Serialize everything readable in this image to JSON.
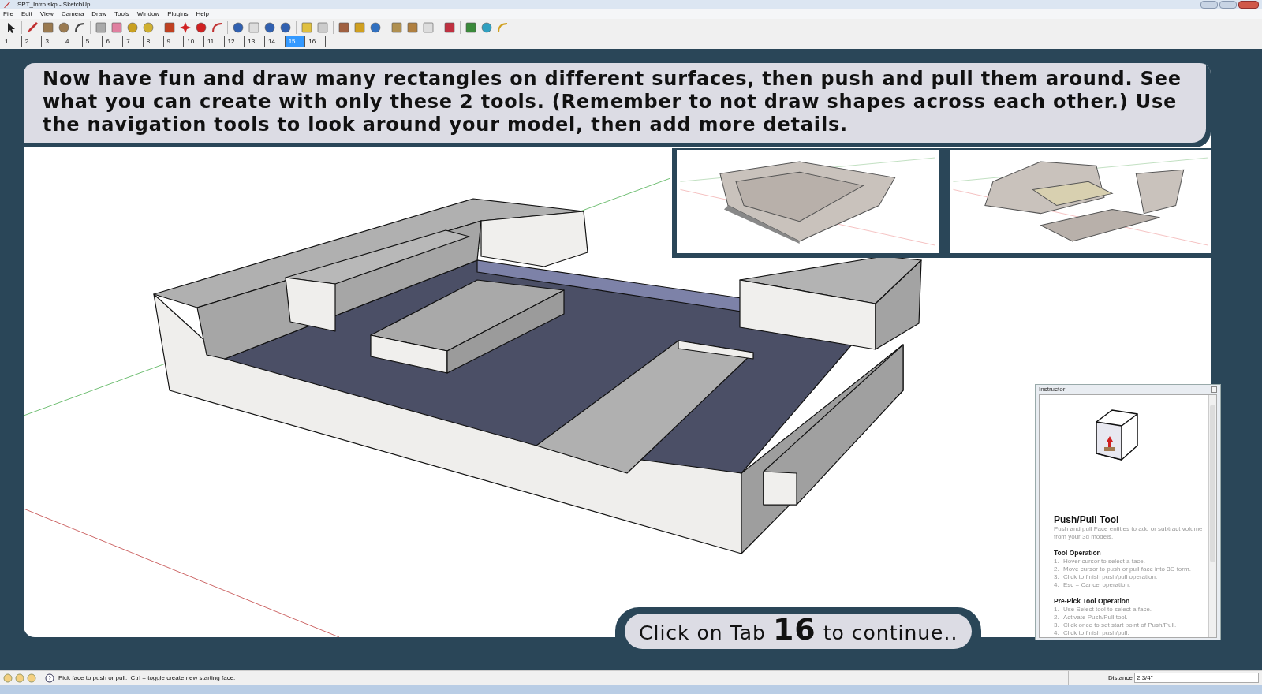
{
  "window": {
    "title": "SPT_Intro.skp - SketchUp"
  },
  "menu": [
    "File",
    "Edit",
    "View",
    "Camera",
    "Draw",
    "Tools",
    "Window",
    "Plugins",
    "Help"
  ],
  "scene_tabs": [
    {
      "label": "1",
      "selected": false
    },
    {
      "label": "2",
      "selected": false
    },
    {
      "label": "3",
      "selected": false
    },
    {
      "label": "4",
      "selected": false
    },
    {
      "label": "5",
      "selected": false
    },
    {
      "label": "6",
      "selected": false
    },
    {
      "label": "7",
      "selected": false
    },
    {
      "label": "8",
      "selected": false
    },
    {
      "label": "9",
      "selected": false
    },
    {
      "label": "10",
      "selected": false
    },
    {
      "label": "11",
      "selected": false
    },
    {
      "label": "12",
      "selected": false
    },
    {
      "label": "13",
      "selected": false
    },
    {
      "label": "14",
      "selected": false
    },
    {
      "label": "15",
      "selected": true
    },
    {
      "label": "16",
      "selected": false
    }
  ],
  "banner": {
    "text": "Now have fun and draw many rectangles on different surfaces, then push and pull them around. See what you can create with only these 2 tools. (Remember to not draw shapes across each other.) Use the navigation tools to look around your model, then add more details."
  },
  "callout": {
    "text_before": "Click on Tab",
    "number": "16",
    "text_after": "to continue.."
  },
  "instructor": {
    "title": "Instructor",
    "tool_name": "Push/Pull Tool",
    "description": "Push and pull Face entities to add or subtract volume from your 3d models.",
    "sections": [
      {
        "heading": "Tool Operation",
        "steps": [
          {
            "number": "1.",
            "text": "Hover cursor to select a face."
          },
          {
            "number": "2.",
            "text": "Move cursor to push or pull face into 3D form."
          },
          {
            "number": "3.",
            "text": "Click to finish push/pull operation."
          },
          {
            "number": "4.",
            "text": "Esc = Cancel operation."
          }
        ]
      },
      {
        "heading": "Pre-Pick Tool Operation",
        "steps": [
          {
            "number": "1.",
            "text": "Use Select tool to select a face."
          },
          {
            "number": "2.",
            "text": "Activate Push/Pull tool."
          },
          {
            "number": "3.",
            "text": "Click once to set start point of Push/Pull."
          },
          {
            "number": "4.",
            "text": "Click to finish push/pull."
          }
        ]
      }
    ]
  },
  "status_bar": {
    "hint": "Pick face to push or pull.  Ctrl = toggle create new starting face.",
    "distance_label": "Distance",
    "distance_value": "2 3/4\""
  }
}
